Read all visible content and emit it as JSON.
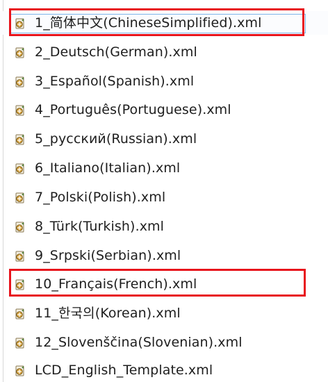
{
  "files": [
    {
      "name": "1_简体中文(ChineseSimplified).xml",
      "icon": "xml-file-icon",
      "selected": true,
      "highlighted": true
    },
    {
      "name": "2_Deutsch(German).xml",
      "icon": "xml-file-icon"
    },
    {
      "name": "3_Español(Spanish).xml",
      "icon": "xml-file-icon"
    },
    {
      "name": "4_Português(Portuguese).xml",
      "icon": "xml-file-icon"
    },
    {
      "name": "5_русский(Russian).xml",
      "icon": "xml-file-icon"
    },
    {
      "name": "6_Italiano(Italian).xml",
      "icon": "xml-file-icon"
    },
    {
      "name": "7_Polski(Polish).xml",
      "icon": "xml-file-icon"
    },
    {
      "name": "8_Türk(Turkish).xml",
      "icon": "xml-file-icon"
    },
    {
      "name": "9_Srpski(Serbian).xml",
      "icon": "xml-file-icon"
    },
    {
      "name": "10_Français(French).xml",
      "icon": "xml-file-icon",
      "highlighted": true
    },
    {
      "name": "11_한국의(Korean).xml",
      "icon": "xml-file-icon"
    },
    {
      "name": "12_Slovenščina(Slovenian).xml",
      "icon": "xml-file-icon"
    },
    {
      "name": "LCD_English_Template.xml",
      "icon": "xml-file-icon"
    }
  ],
  "colors": {
    "highlight": "#e8141c",
    "selection_outline": "#7fb4e8",
    "text": "#1e1e1e"
  }
}
